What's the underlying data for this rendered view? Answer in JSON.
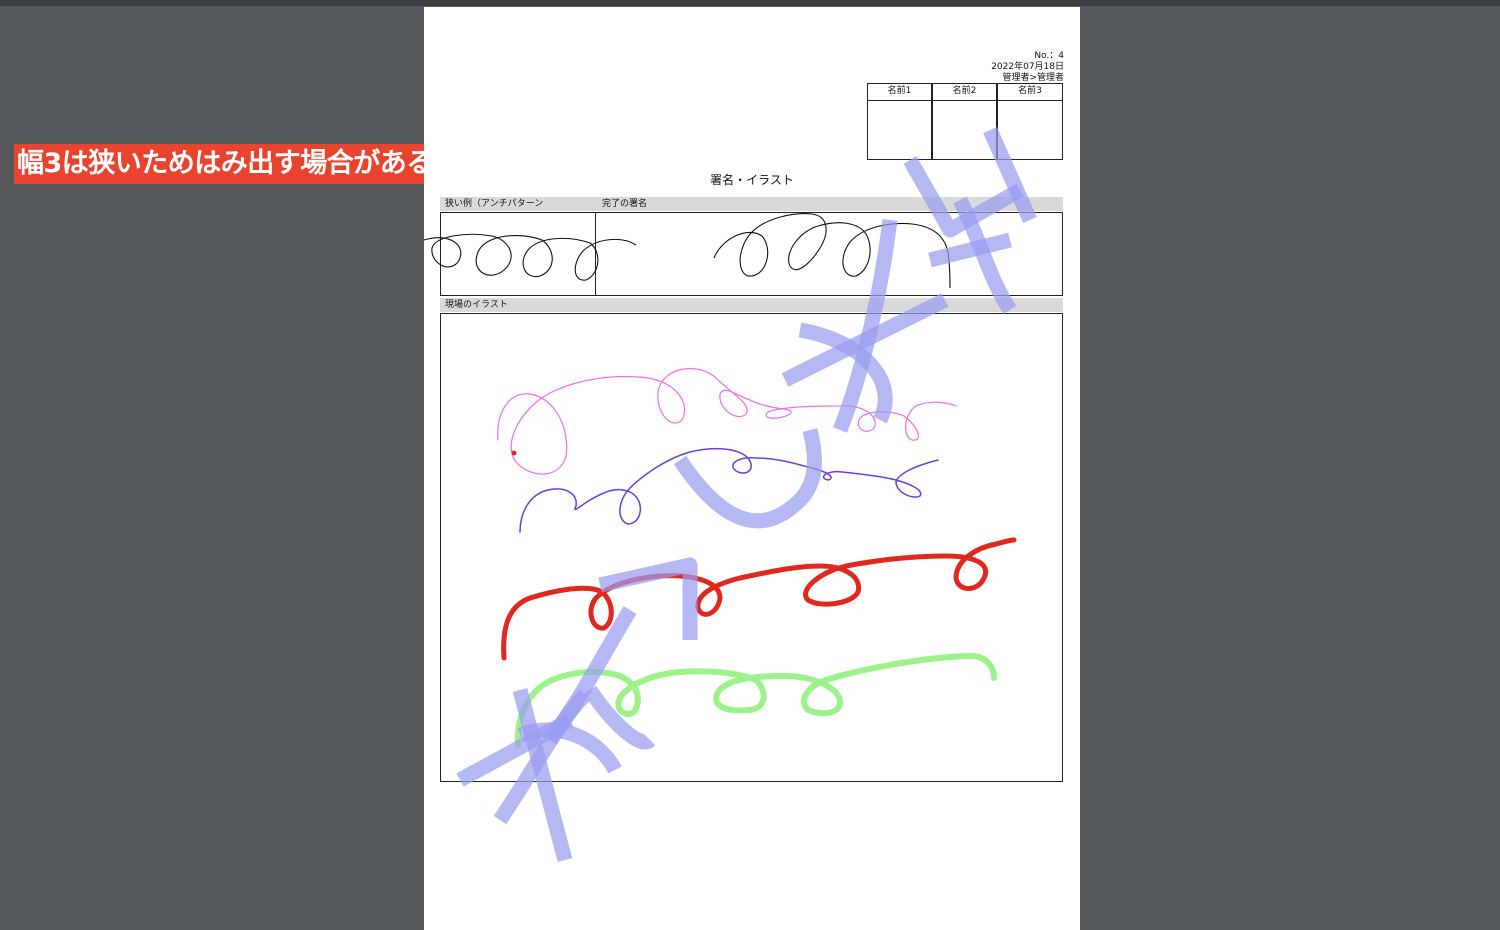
{
  "callout": {
    "text": "幅3は狭いためはみ出す場合がある▼"
  },
  "document": {
    "number": "No.：4",
    "date": "2022年07月18日",
    "author": "管理者>管理者",
    "approvals": [
      "名前1",
      "名前2",
      "名前3"
    ],
    "title": "署名・イラスト",
    "signature_section": {
      "narrow_label": "狭い例（アンチパターン",
      "done_label": "完了の署名"
    },
    "illustration_section": {
      "label": "現場のイラスト"
    },
    "watermark": "透かし文字",
    "stroke_colors": [
      "#111111",
      "#ee6fe8",
      "#6a3fd4",
      "#e0281f",
      "#9df28c"
    ],
    "watermark_color": "#9a9cf0"
  }
}
